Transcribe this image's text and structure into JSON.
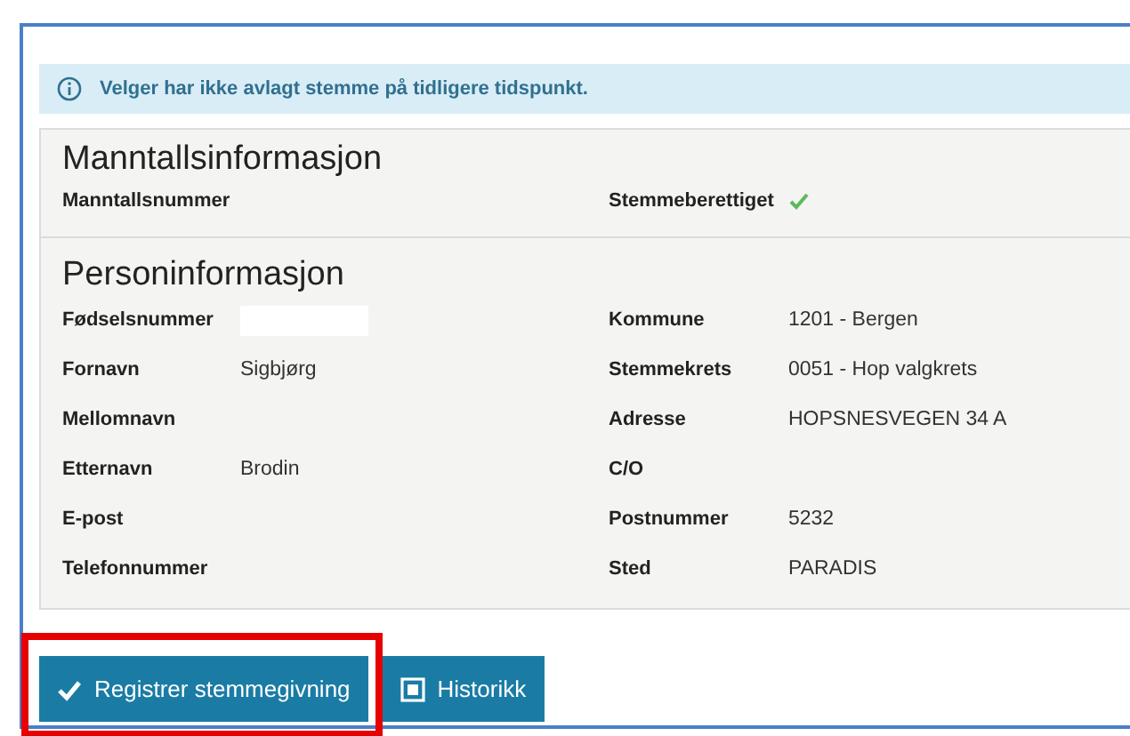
{
  "alert": {
    "text": "Velger har ikke avlagt stemme på tidligere tidspunkt."
  },
  "sections": [
    {
      "title": "Manntallsinformasjon",
      "rows": [
        {
          "left": {
            "label": "Manntallsnummer"
          },
          "right": {
            "label": "Stemmeberettiget",
            "kind": "check",
            "checked": true
          }
        }
      ]
    },
    {
      "title": "Personinformasjon",
      "rows": [
        {
          "left": {
            "label": "Fødselsnummer",
            "redacted": true
          },
          "right": {
            "label": "Kommune",
            "value": "1201 - Bergen"
          }
        },
        {
          "left": {
            "label": "Fornavn",
            "value": "Sigbjørg"
          },
          "right": {
            "label": "Stemmekrets",
            "value": "0051 - Hop valgkrets"
          }
        },
        {
          "left": {
            "label": "Mellomnavn"
          },
          "right": {
            "label": "Adresse",
            "value": "HOPSNESVEGEN 34 A"
          }
        },
        {
          "left": {
            "label": "Etternavn",
            "value": "Brodin"
          },
          "right": {
            "label": "C/O"
          }
        },
        {
          "left": {
            "label": "E-post"
          },
          "right": {
            "label": "Postnummer",
            "value": "5232"
          }
        },
        {
          "left": {
            "label": "Telefonnummer"
          },
          "right": {
            "label": "Sted",
            "value": "PARADIS"
          }
        }
      ]
    }
  ],
  "buttons": [
    {
      "label": "Registrer stemmegivning",
      "kind": "check",
      "highlighted": true
    },
    {
      "label": "Historikk",
      "kind": "document",
      "highlighted": false
    }
  ]
}
